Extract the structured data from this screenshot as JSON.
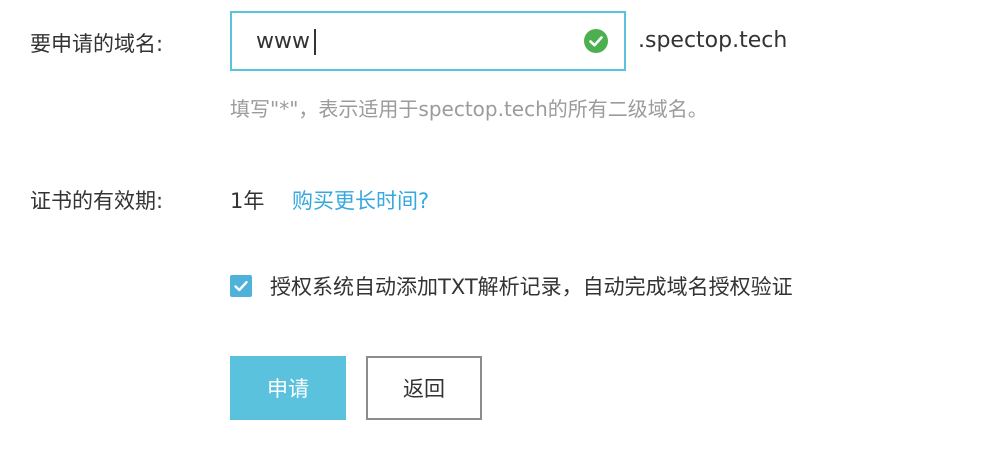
{
  "form": {
    "domain_label": "要申请的域名:",
    "domain_value": "www",
    "domain_valid_icon": "check-circle-icon",
    "domain_suffix": ".spectop.tech",
    "domain_hint": "填写\"*\"，表示适用于spectop.tech的所有二级域名。",
    "validity_label": "证书的有效期:",
    "validity_value": "1年",
    "buy_longer_link": "购买更长时间?",
    "auto_txt_checked": true,
    "auto_txt_label": "授权系统自动添加TXT解析记录，自动完成域名授权验证"
  },
  "actions": {
    "submit_label": "申请",
    "back_label": "返回"
  },
  "colors": {
    "accent": "#5bc2dd",
    "link": "#36a8e0",
    "valid": "#4caf50",
    "hint_text": "#9b9b9b"
  }
}
